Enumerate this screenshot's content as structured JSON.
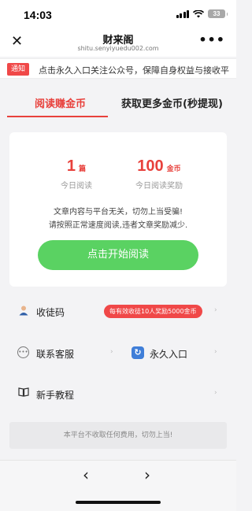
{
  "status_bar": {
    "time": "14:03",
    "battery": "33"
  },
  "header": {
    "title": "财来阁",
    "url": "shitu.senyiyuedu002.com",
    "close_icon": "close-icon",
    "more_icon": "more-icon"
  },
  "notice": {
    "tag": "通知",
    "text": "点击永久入口关注公众号，保障自身权益与接收平"
  },
  "tabs": [
    {
      "label": "阅读赚金币",
      "active": true
    },
    {
      "label": "获取更多金币(秒提现)",
      "active": false
    }
  ],
  "stats": {
    "read_count": "1",
    "read_unit": "篇",
    "read_label": "今日阅读",
    "reward_count": "100",
    "reward_unit": "金币",
    "reward_label": "今日阅读奖励"
  },
  "card": {
    "notice_line1": "文章内容与平台无关，切勿上当受骗!",
    "notice_line2": "请按照正常速度阅读,违者文章奖励减少.",
    "start_button": "点击开始阅读"
  },
  "menu": {
    "invite_label": "收徒码",
    "invite_badge": "每有效收徒10人奖励5000金币",
    "service_label": "联系客服",
    "permanent_label": "永久入口",
    "tutorial_label": "新手教程"
  },
  "footer_note": "本平台不收取任何费用，切勿上当!",
  "colors": {
    "accent": "#e8413c",
    "button": "#5ad262",
    "badge": "#f04848"
  }
}
